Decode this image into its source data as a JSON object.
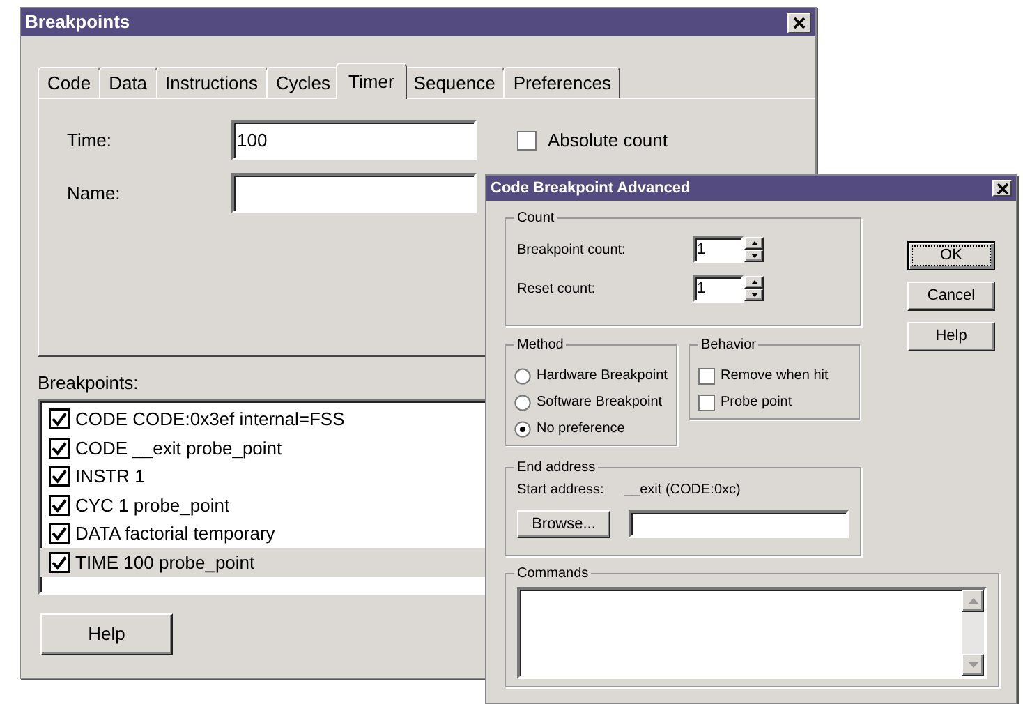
{
  "main_window": {
    "title": "Breakpoints",
    "tabs": [
      {
        "label": "Code",
        "selected": false
      },
      {
        "label": "Data",
        "selected": false
      },
      {
        "label": "Instructions",
        "selected": false
      },
      {
        "label": "Cycles",
        "selected": false
      },
      {
        "label": "Timer",
        "selected": true
      },
      {
        "label": "Sequence",
        "selected": false
      },
      {
        "label": "Preferences",
        "selected": false
      }
    ],
    "time": {
      "label": "Time:",
      "value": "100"
    },
    "name": {
      "label": "Name:"
    },
    "absolute_count": {
      "label": "Absolute count",
      "checked": false
    },
    "breakpoints_label": "Breakpoints:",
    "breakpoints": [
      {
        "label": "CODE CODE:0x3ef internal=FSS",
        "checked": true,
        "selected": false
      },
      {
        "label": "CODE __exit probe_point",
        "checked": true,
        "selected": false
      },
      {
        "label": "INSTR 1",
        "checked": true,
        "selected": false
      },
      {
        "label": "CYC 1 probe_point",
        "checked": true,
        "selected": false
      },
      {
        "label": "DATA factorial temporary",
        "checked": true,
        "selected": false
      },
      {
        "label": "TIME 100 probe_point",
        "checked": true,
        "selected": true
      }
    ],
    "help_button": "Help"
  },
  "dialog": {
    "title": "Code Breakpoint Advanced",
    "count": {
      "title": "Count",
      "spinners": [
        {
          "label": "Breakpoint count:",
          "value": "1"
        },
        {
          "label": "Reset count:",
          "value": "1"
        }
      ]
    },
    "method": {
      "title": "Method",
      "options": [
        {
          "label": "Hardware Breakpoint",
          "selected": false
        },
        {
          "label": "Software Breakpoint",
          "selected": false
        },
        {
          "label": "No preference",
          "selected": true
        }
      ]
    },
    "behavior": {
      "title": "Behavior",
      "options": [
        {
          "label": "Remove when hit",
          "checked": false
        },
        {
          "label": "Probe point",
          "checked": false
        }
      ]
    },
    "end_address": {
      "title": "End address",
      "start_label": "Start address:",
      "start_value": "__exit (CODE:0xc)",
      "browse_button": "Browse..."
    },
    "commands": {
      "title": "Commands"
    },
    "buttons": [
      {
        "label": "OK",
        "focused": true
      },
      {
        "label": "Cancel",
        "focused": false
      },
      {
        "label": "Help",
        "focused": false
      }
    ]
  }
}
